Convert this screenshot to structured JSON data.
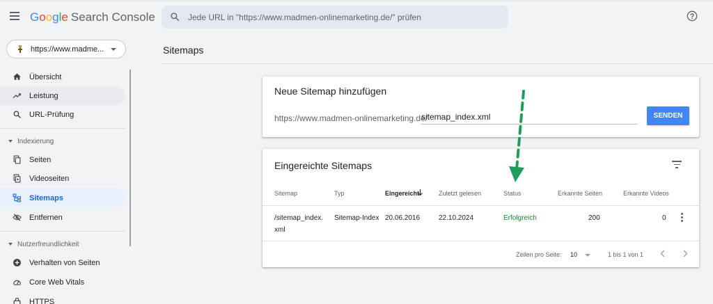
{
  "header": {
    "logo_letters": [
      "G",
      "o",
      "o",
      "g",
      "l",
      "e"
    ],
    "logo_rest": "Search Console",
    "search_placeholder": "Jede URL in \"https://www.madmen-onlinemarketing.de/\" prüfen"
  },
  "property": {
    "label": "https://www.madme..."
  },
  "sidebar": {
    "items": [
      {
        "label": "Übersicht",
        "icon": "home-icon"
      },
      {
        "label": "Leistung",
        "icon": "trending-up-icon"
      },
      {
        "label": "URL-Prüfung",
        "icon": "search-icon"
      }
    ],
    "section_indexing": "Indexierung",
    "indexing_items": [
      {
        "label": "Seiten",
        "icon": "pages-icon"
      },
      {
        "label": "Videoseiten",
        "icon": "video-pages-icon"
      },
      {
        "label": "Sitemaps",
        "icon": "sitemap-icon"
      },
      {
        "label": "Entfernen",
        "icon": "eye-off-icon"
      }
    ],
    "section_ux": "Nutzerfreundlichkeit",
    "ux_items": [
      {
        "label": "Verhalten von Seiten",
        "icon": "plus-circle-icon"
      },
      {
        "label": "Core Web Vitals",
        "icon": "speed-gauge-icon"
      },
      {
        "label": "HTTPS",
        "icon": "lock-icon"
      }
    ]
  },
  "main": {
    "page_title": "Sitemaps",
    "add_card": {
      "title": "Neue Sitemap hinzufügen",
      "prefix": "https://www.madmen-onlinemarketing.de/",
      "input_value": "sitemap_index.xml",
      "button_label": "SENDEN"
    },
    "submitted_card": {
      "title": "Eingereichte Sitemaps",
      "columns": [
        "Sitemap",
        "Typ",
        "Eingereicht",
        "Zuletzt gelesen",
        "Status",
        "Erkannte Seiten",
        "Erkannte Videos"
      ],
      "rows": [
        {
          "sitemap": "/sitemap_index.xml",
          "type": "Sitemap-Index",
          "submitted": "20.06.2016",
          "last_read": "22.10.2024",
          "status": "Erfolgreich",
          "pages": "200",
          "videos": "0"
        }
      ],
      "pagination": {
        "rows_per_page_label": "Zeilen pro Seite:",
        "rows_per_page": "10",
        "range": "1 bis 1 von 1"
      }
    }
  },
  "colors": {
    "accent": "#4285f4",
    "active_nav_bg": "#e8f0fe",
    "status_success": "#188038",
    "annotation_arrow": "#1e9e5a"
  }
}
